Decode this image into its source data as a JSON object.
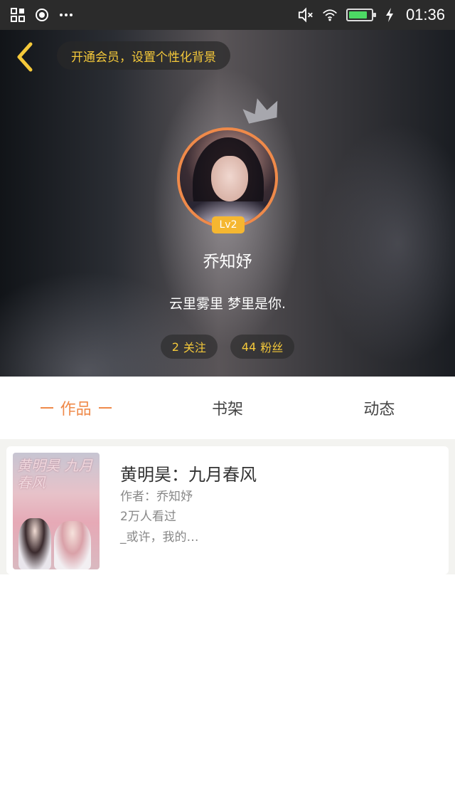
{
  "status_bar": {
    "time": "01:36",
    "left_icons": [
      "grid-icon",
      "record-icon",
      "more-dots-icon"
    ],
    "right_icons": [
      "mute-icon",
      "wifi-icon",
      "battery-icon",
      "charging-icon"
    ],
    "battery_level": 0.85
  },
  "header": {
    "vip_prompt": "开通会员，设置个性化背景",
    "level": "Lv2",
    "username": "乔知妤",
    "bio": "云里雾里 梦里是你.",
    "following_count": "2",
    "following_label": "关注",
    "followers_count": "44",
    "followers_label": "粉丝"
  },
  "tabs": [
    {
      "label": "作品",
      "active": true
    },
    {
      "label": "书架",
      "active": false
    },
    {
      "label": "动态",
      "active": false
    }
  ],
  "books": [
    {
      "cover_text": "黄明昊 九月春风",
      "title": "黄明昊：九月春风",
      "author": "作者：乔知妤",
      "views": "2万人看过",
      "excerpt": "_或许，我的…"
    }
  ],
  "colors": {
    "accent": "#ef8a4a",
    "gold": "#f5c93a",
    "badge": "#f5b731",
    "status_bar": "#2b2b2b"
  }
}
